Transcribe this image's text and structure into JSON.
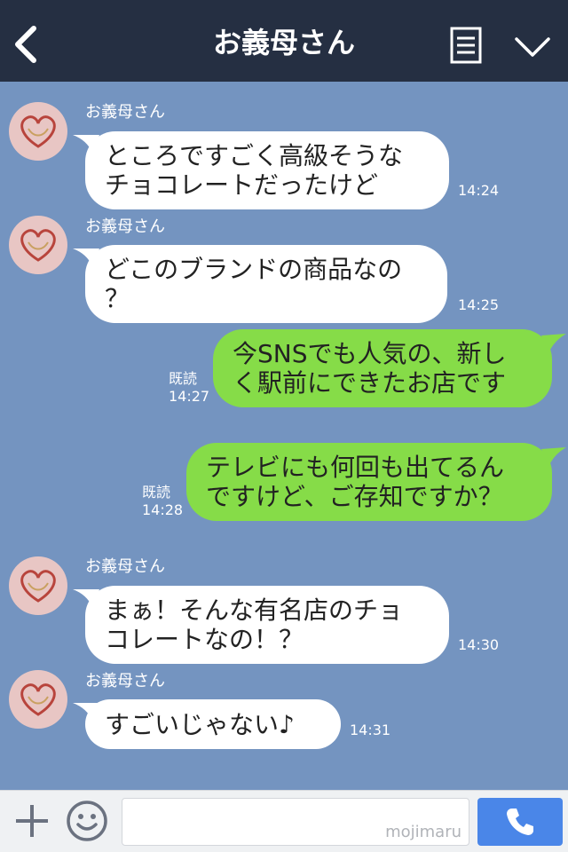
{
  "header": {
    "title": "お義母さん",
    "back_icon": "chevron-left-icon",
    "menu_icon": "list-icon",
    "expand_icon": "chevron-down-icon",
    "background": "#252f42"
  },
  "chat": {
    "background": "#7494c0",
    "messages": [
      {
        "direction": "in",
        "sender": "お義母さん",
        "lines": [
          "ところですごく高級そうな",
          "チョコレートだったけど"
        ],
        "time": "14:24"
      },
      {
        "direction": "in",
        "sender": "お義母さん",
        "lines": [
          "どこのブランドの商品なの",
          "？"
        ],
        "time": "14:25"
      },
      {
        "direction": "out",
        "read": "既読",
        "lines": [
          "今SNSでも人気の、新し",
          "く駅前にできたお店です"
        ],
        "time": "14:27"
      },
      {
        "direction": "out",
        "read": "既読",
        "lines": [
          "テレビにも何回も出てるん",
          "ですけど、ご存知ですか？"
        ],
        "time": "14:28"
      },
      {
        "direction": "in",
        "sender": "お義母さん",
        "lines": [
          "まぁ！そんな有名店のチョ",
          "コレートなの！？"
        ],
        "time": "14:30"
      },
      {
        "direction": "in",
        "sender": "お義母さん",
        "lines": [
          "すごいじゃない♪"
        ],
        "time": "14:31"
      }
    ]
  },
  "footer": {
    "plus_icon": "plus-icon",
    "emoji_icon": "smiley-icon",
    "input_value": "",
    "watermark": "mojimaru",
    "call_icon": "phone-icon",
    "call_color": "#4a86e8"
  },
  "colors": {
    "incoming_bubble": "#ffffff",
    "outgoing_bubble": "#86dc48"
  }
}
